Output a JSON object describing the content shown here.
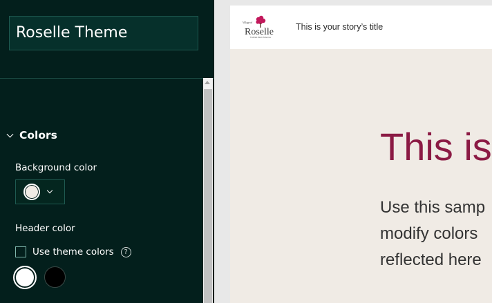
{
  "panel": {
    "theme_name": "Roselle Theme",
    "section": {
      "title": "Colors",
      "expanded": true
    },
    "background_color": {
      "label": "Background color",
      "value": "#f0ebe5"
    },
    "header_color": {
      "label": "Header color",
      "use_theme_colors": {
        "label": "Use theme colors",
        "checked": false
      },
      "help_icon": "?",
      "swatches": [
        "#ffffff",
        "#000000"
      ],
      "selected": "#ffffff"
    }
  },
  "preview": {
    "logo": {
      "line1": "Village of",
      "line2": "Roselle",
      "line3": "Tradition Meets Tomorrow"
    },
    "story_title": "This is your story’s title",
    "headline": "This is",
    "body_lines": [
      "Use this samp",
      "modify colors",
      "reflected here"
    ]
  },
  "colors": {
    "panel_bg": "#031f1c",
    "preview_bg": "#f0ebe5",
    "accent": "#8b1a44"
  }
}
